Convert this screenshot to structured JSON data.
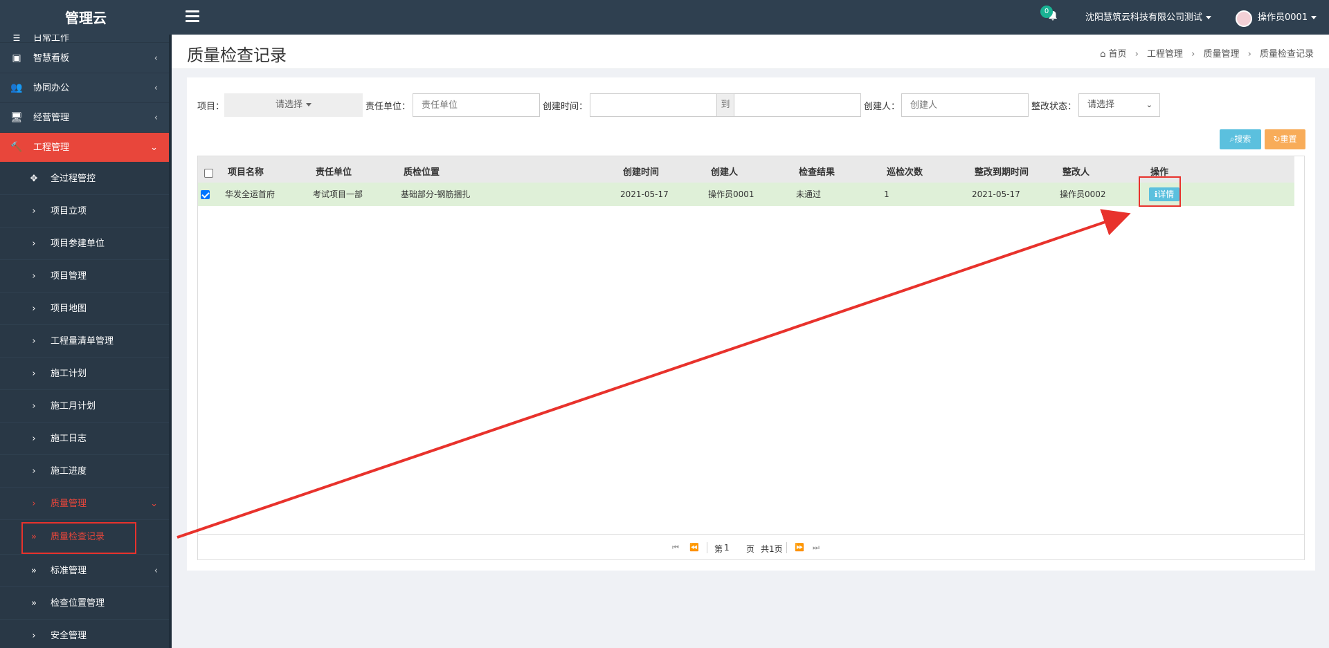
{
  "brand": "管理云",
  "topbar": {
    "notification_count": "0",
    "company": "沈阳慧筑云科技有限公司测试",
    "user": "操作员0001"
  },
  "sidebar": {
    "items": [
      {
        "label": "日常工作",
        "icon": "list-icon"
      },
      {
        "label": "智慧看板",
        "icon": "dashboard-icon",
        "arrow": "‹"
      },
      {
        "label": "协同办公",
        "icon": "users-icon",
        "arrow": "‹"
      },
      {
        "label": "经营管理",
        "icon": "monitor-icon",
        "arrow": "‹"
      },
      {
        "label": "工程管理",
        "icon": "gavel-icon",
        "arrow": "⌄"
      }
    ],
    "sub_items": [
      {
        "label": "全过程管控",
        "icon": "crosshair-icon"
      },
      {
        "label": "项目立项"
      },
      {
        "label": "项目参建单位"
      },
      {
        "label": "项目管理"
      },
      {
        "label": "项目地图"
      },
      {
        "label": "工程量清单管理"
      },
      {
        "label": "施工计划"
      },
      {
        "label": "施工月计划"
      },
      {
        "label": "施工日志"
      },
      {
        "label": "施工进度"
      },
      {
        "label": "质量管理"
      },
      {
        "label": "质量检查记录"
      },
      {
        "label": "标准管理"
      },
      {
        "label": "检查位置管理"
      },
      {
        "label": "安全管理"
      }
    ]
  },
  "page": {
    "title": "质量检查记录",
    "breadcrumb": [
      "首页",
      "工程管理",
      "质量管理",
      "质量检查记录"
    ]
  },
  "filters": {
    "project_label": "项目：",
    "project_value": "请选择",
    "unit_label": "责任单位：",
    "unit_placeholder": "责任单位",
    "created_label": "创建时间：",
    "to_label": "到",
    "creator_label": "创建人：",
    "creator_placeholder": "创建人",
    "status_label": "整改状态：",
    "status_value": "请选择",
    "search_label": "搜索",
    "reset_label": "重置"
  },
  "table": {
    "columns": [
      "项目名称",
      "责任单位",
      "质检位置",
      "创建时间",
      "创建人",
      "检查结果",
      "巡检次数",
      "整改到期时间",
      "整改人",
      "操作"
    ],
    "rows": [
      {
        "project": "华发全运首府",
        "unit": "考试项目一部",
        "location": "基础部分-钢筋捆扎",
        "created": "2021-05-17",
        "creator": "操作员0001",
        "result": "未通过",
        "count": "1",
        "due": "2021-05-17",
        "rectifier": "操作员0002",
        "action": "详情"
      }
    ]
  },
  "pager": {
    "page_prefix": "第",
    "page_num": "1",
    "page_suffix": "页",
    "total": "共1页"
  },
  "colors": {
    "sidebar_bg": "#2f4050",
    "active_red": "#e8463b",
    "row_selected": "#dff0d8",
    "info_blue": "#5bc0de",
    "warning_orange": "#f8ac59"
  }
}
